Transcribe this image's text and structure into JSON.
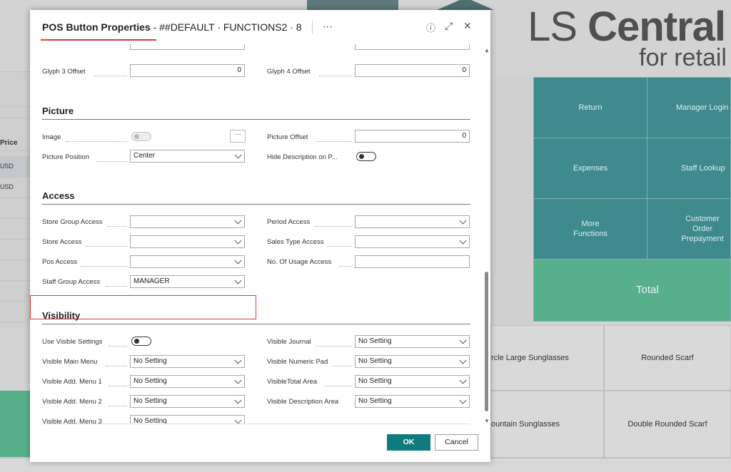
{
  "background": {
    "brand": {
      "line1_light": "LS ",
      "line1_bold": "Central",
      "line2": "for retail"
    },
    "left_column": {
      "header": "Price",
      "rows": [
        "USD",
        "USD"
      ]
    },
    "tiles": [
      {
        "label": "Return"
      },
      {
        "label": "Manager Login"
      },
      {
        "label": "Expenses"
      },
      {
        "label": "Staff Lookup"
      },
      {
        "label": "More\nFunctions"
      },
      {
        "label": "Customer Order\nPrepayment"
      }
    ],
    "total_label": "Total",
    "items": [
      "rcle Large Sunglasses",
      "Rounded Scarf",
      "ountain Sunglasses",
      "Double Rounded Scarf"
    ]
  },
  "dialog": {
    "title_bold": "POS Button Properties",
    "title_rest": " - ##DEFAULT · FUNCTIONS2 · 8",
    "more_icon": "⋯",
    "info_icon": "ⓘ",
    "expand_icon": "⤢",
    "close_icon": "✕",
    "glyph": {
      "glyph3_label": "Glyph 3 Offset",
      "glyph3_value": "0",
      "glyph4_label": "Glyph 4 Offset",
      "glyph4_value": "0"
    },
    "picture": {
      "heading": "Picture",
      "image_label": "Image",
      "image_more": "···",
      "picture_offset_label": "Picture Offset",
      "picture_offset_value": "0",
      "picture_position_label": "Picture Position",
      "picture_position_value": "Center",
      "hide_desc_label": "Hide Description on P..."
    },
    "access": {
      "heading": "Access",
      "store_group_label": "Store Group Access",
      "store_group_value": "",
      "period_label": "Period Access",
      "period_value": "",
      "store_label": "Store Access",
      "store_value": "",
      "sales_type_label": "Sales Type Access",
      "sales_type_value": "",
      "pos_label": "Pos Access",
      "pos_value": "",
      "usage_label": "No. Of Usage Access",
      "usage_value": "",
      "staff_group_label": "Staff Group Access",
      "staff_group_value": "MANAGER"
    },
    "visibility": {
      "heading": "Visibility",
      "use_visible_label": "Use Visible Settings",
      "journal_label": "Visible Journal",
      "journal_value": "No Setting",
      "main_menu_label": "Visible Main Menu",
      "main_menu_value": "No Setting",
      "numeric_pad_label": "Visible Numeric Pad",
      "numeric_pad_value": "No Setting",
      "add_menu1_label": "Visible Add. Menu 1",
      "add_menu1_value": "No Setting",
      "total_area_label": "VisibleTotal Area",
      "total_area_value": "No Setting",
      "add_menu2_label": "Visible Add. Menu 2",
      "add_menu2_value": "No Setting",
      "desc_area_label": "Visible Description Area",
      "desc_area_value": "No Setting",
      "add_menu3_label": "Visible Add. Menu 3",
      "add_menu3_value": "No Setting"
    },
    "ok_label": "OK",
    "cancel_label": "Cancel"
  },
  "colors": {
    "accent": "#0f7b7e",
    "highlight": "#e53935",
    "tile": "#3f8a8d",
    "total": "#57b08b"
  }
}
